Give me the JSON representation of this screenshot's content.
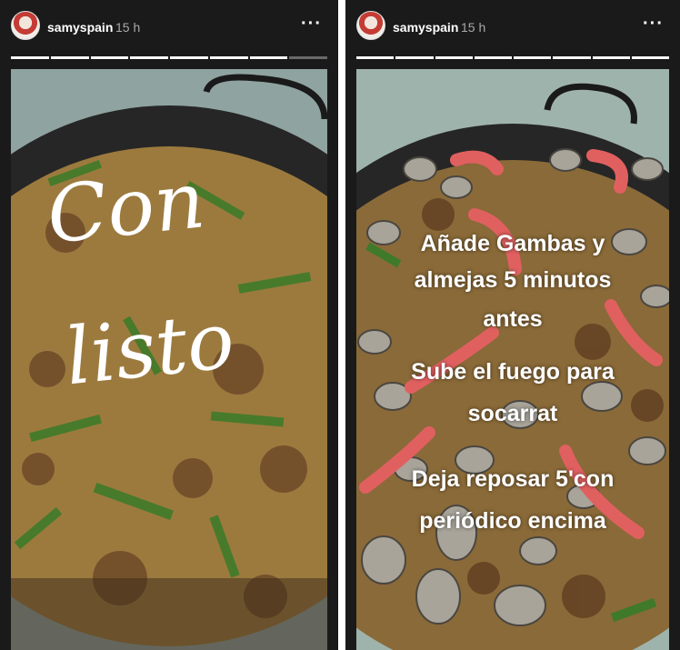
{
  "stories": [
    {
      "username": "samyspain",
      "time": "15 h",
      "more_icon": "···",
      "handwriting": [
        "Con",
        "listo"
      ]
    },
    {
      "username": "samyspain",
      "time": "15 h",
      "more_icon": "···",
      "overlay_lines": [
        "Añade Gambas y",
        "almejas 5 minutos",
        "antes",
        "Sube el fuego para",
        "socarrat",
        "Deja reposar 5'con",
        "periódico encima"
      ]
    }
  ],
  "colors": {
    "background": "#1a1a1a",
    "pan_rim": "#2b2b2b",
    "rice": "#9c7a3e",
    "green_bean": "#3f7a2a",
    "shrimp": "#e06060",
    "clam": "#a8a49a"
  }
}
